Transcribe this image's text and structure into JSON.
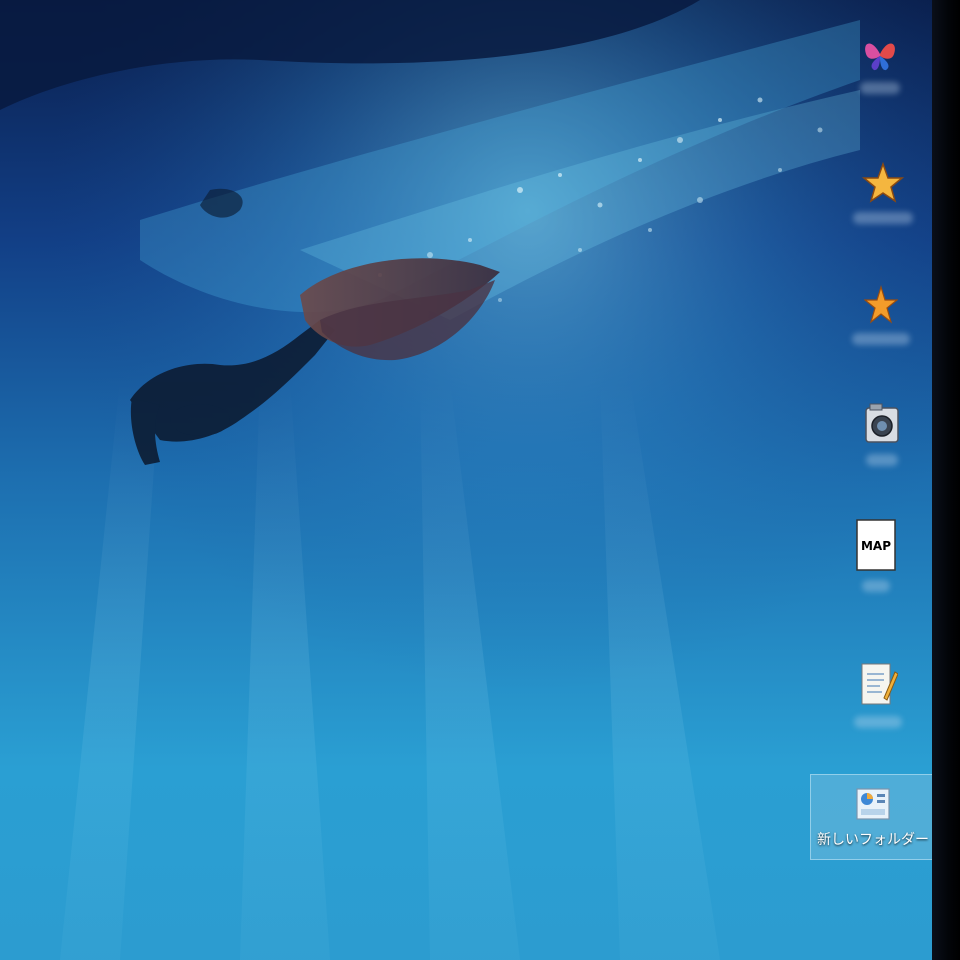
{
  "desktop": {
    "wallpaper": {
      "subject": "underwater-freediver",
      "colors": {
        "deep": "#0b2a5e",
        "mid": "#1b64a6",
        "light": "#2aa3d6",
        "surface": "#6fd0f0"
      }
    },
    "icons": [
      {
        "icon": "butterfly-icon",
        "label_hidden": true
      },
      {
        "icon": "star-icon",
        "label_hidden": true
      },
      {
        "icon": "star-icon",
        "label_hidden": true
      },
      {
        "icon": "camera-icon",
        "label_hidden": true
      },
      {
        "icon": "map-icon",
        "label_hidden": true,
        "glyph_text": "MAP"
      },
      {
        "icon": "notepad-icon",
        "label_hidden": true
      }
    ],
    "selected_folder": {
      "icon": "folder-icon",
      "label": "新しいフォルダー"
    }
  }
}
